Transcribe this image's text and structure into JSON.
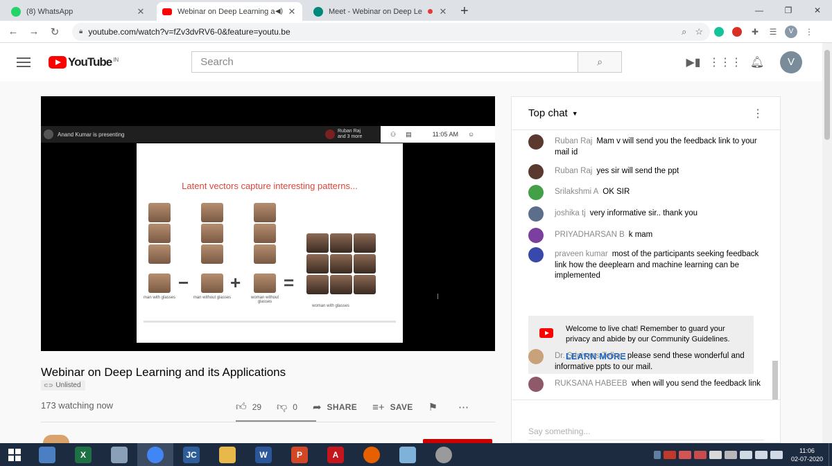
{
  "browser": {
    "tabs": [
      {
        "title": "(8) WhatsApp",
        "favicon_color": "#25d366",
        "active": false
      },
      {
        "title": "Webinar on Deep Learning a",
        "favicon_color": "#ff0000",
        "active": true
      },
      {
        "title": "Meet - Webinar on Deep Le",
        "favicon_color": "#00897b",
        "active": false
      }
    ],
    "new_tab": "+",
    "window_controls": {
      "minimize": "—",
      "maximize": "❐",
      "close": "✕"
    },
    "nav": {
      "back": "←",
      "forward": "→",
      "reload": "↻"
    },
    "url": "youtube.com/watch?v=fZv3dvRV6-0&feature=youtu.be",
    "profile_initial": "V"
  },
  "youtube": {
    "logo_text": "YouTube",
    "country_code": "IN",
    "search_placeholder": "Search",
    "avatar_initial": "V"
  },
  "player": {
    "presenter_text": "Anand Kumar is presenting",
    "participants_text": "Ruban Raj and 3 more",
    "meet_time": "11:05 AM",
    "slide_title": "Latent vectors capture interesting patterns...",
    "captions": [
      "man with glasses",
      "man without glasses",
      "woman without glasses",
      "woman with glasses"
    ],
    "operators": [
      "−",
      "+",
      "="
    ]
  },
  "video": {
    "title": "Webinar on Deep Learning and its Applications",
    "visibility": "Unlisted",
    "watching": "173 watching now",
    "like_count": "29",
    "dislike_count": "0",
    "share_label": "SHARE",
    "save_label": "SAVE"
  },
  "chat": {
    "header": "Top chat",
    "messages": [
      {
        "author": "Ruban Raj",
        "text": "Mam v will send you the feedback link to your mail id",
        "avatar_color": "#5a3a2e"
      },
      {
        "author": "Ruban Raj",
        "text": "yes sir will send the ppt",
        "avatar_color": "#5a3a2e"
      },
      {
        "author": "Srilakshmi A",
        "text": "OK SIR",
        "avatar_color": "#43a047"
      },
      {
        "author": "joshika tj",
        "text": "very informative sir.. thank you",
        "avatar_color": "#5c6f8a"
      },
      {
        "author": "PRIYADHARSAN B",
        "text": "k mam",
        "avatar_color": "#7b3fa0"
      },
      {
        "author": "praveen kumar",
        "text": "most of the participants seeking feedback link how the deeplearn and machine learning can be implemented",
        "avatar_color": "#3949ab"
      },
      {
        "author": "Dr. Srinivaas Telkar",
        "text": "please send these wonderful and informative ppts to our mail.",
        "avatar_color": "#c9a27a"
      },
      {
        "author": "RUKSANA HABEEB",
        "text": "when will you send the feedback link",
        "avatar_color": "#8e5a6a"
      }
    ],
    "welcome_text": "Welcome to live chat! Remember to guard your privacy and abide by our Community Guidelines.",
    "learn_more": "LEARN MORE",
    "input_placeholder": "Say something..."
  },
  "taskbar": {
    "apps": [
      {
        "name": "app-3d",
        "color": "#4a7fc1",
        "glyph": ""
      },
      {
        "name": "excel",
        "color": "#1e7145",
        "glyph": "X"
      },
      {
        "name": "paint",
        "color": "#8aa0b8",
        "glyph": ""
      },
      {
        "name": "chrome",
        "color": "#4285f4",
        "glyph": ""
      },
      {
        "name": "app-jc",
        "color": "#2e5d9a",
        "glyph": "JC"
      },
      {
        "name": "explorer",
        "color": "#e8b84a",
        "glyph": ""
      },
      {
        "name": "word",
        "color": "#2b579a",
        "glyph": "W"
      },
      {
        "name": "powerpoint",
        "color": "#d24726",
        "glyph": "P"
      },
      {
        "name": "acrobat",
        "color": "#c4161c",
        "glyph": "A"
      },
      {
        "name": "firefox",
        "color": "#e66000",
        "glyph": ""
      },
      {
        "name": "app-notes",
        "color": "#7fb2d8",
        "glyph": ""
      },
      {
        "name": "media",
        "color": "#9a9a9a",
        "glyph": ""
      }
    ],
    "time": "11:06",
    "date": "02-07-2020"
  }
}
